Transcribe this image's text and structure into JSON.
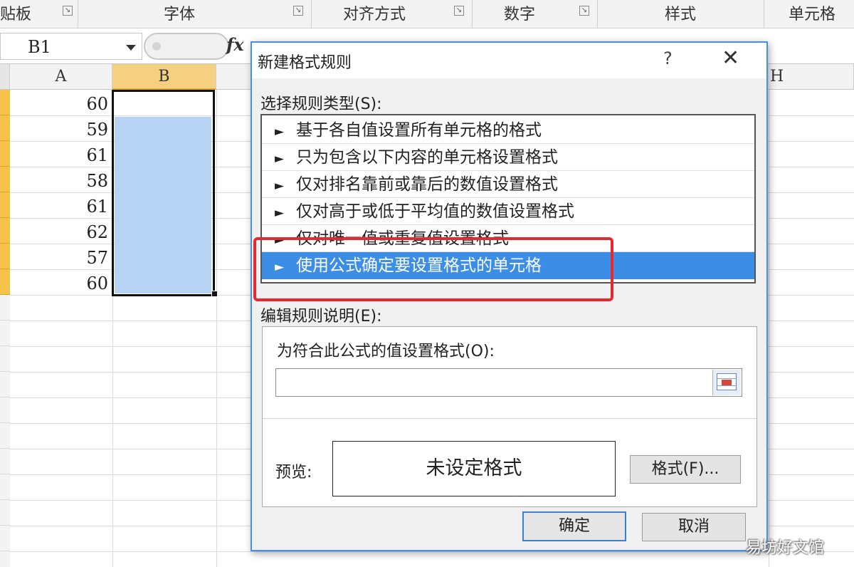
{
  "ribbon": {
    "groups": [
      "贴板",
      "字体",
      "对齐方式",
      "数字",
      "样式",
      "单元格"
    ]
  },
  "formula_bar": {
    "name_box": "B1",
    "fx_label": "fx"
  },
  "sheet": {
    "columns": [
      "A",
      "B",
      "H"
    ],
    "column_a_values": [
      "60",
      "59",
      "61",
      "58",
      "61",
      "62",
      "57",
      "60"
    ],
    "selected_column": "B",
    "selection_color": "#b7d3f3",
    "row_header_highlight": "#f5c24a"
  },
  "dialog": {
    "title": "新建格式规则",
    "help": "?",
    "close": "✕",
    "rule_type_label": "选择规则类型(S):",
    "rule_types": [
      "基于各自值设置所有单元格的格式",
      "只为包含以下内容的单元格设置格式",
      "仅对排名靠前或靠后的数值设置格式",
      "仅对高于或低于平均值的数值设置格式",
      "仅对唯一值或重复值设置格式",
      "使用公式确定要设置格式的单元格"
    ],
    "selected_index": 5,
    "edit_label": "编辑规则说明(E):",
    "formula_label": "为符合此公式的值设置格式(O):",
    "formula_value": "",
    "preview_label": "预览:",
    "preview_text": "未设定格式",
    "format_button": "格式(F)...",
    "ok_button": "确定",
    "cancel_button": "取消",
    "accent_color": "#3c8de6",
    "highlight_color": "#e8282d"
  },
  "watermark": "易坊好文馆"
}
